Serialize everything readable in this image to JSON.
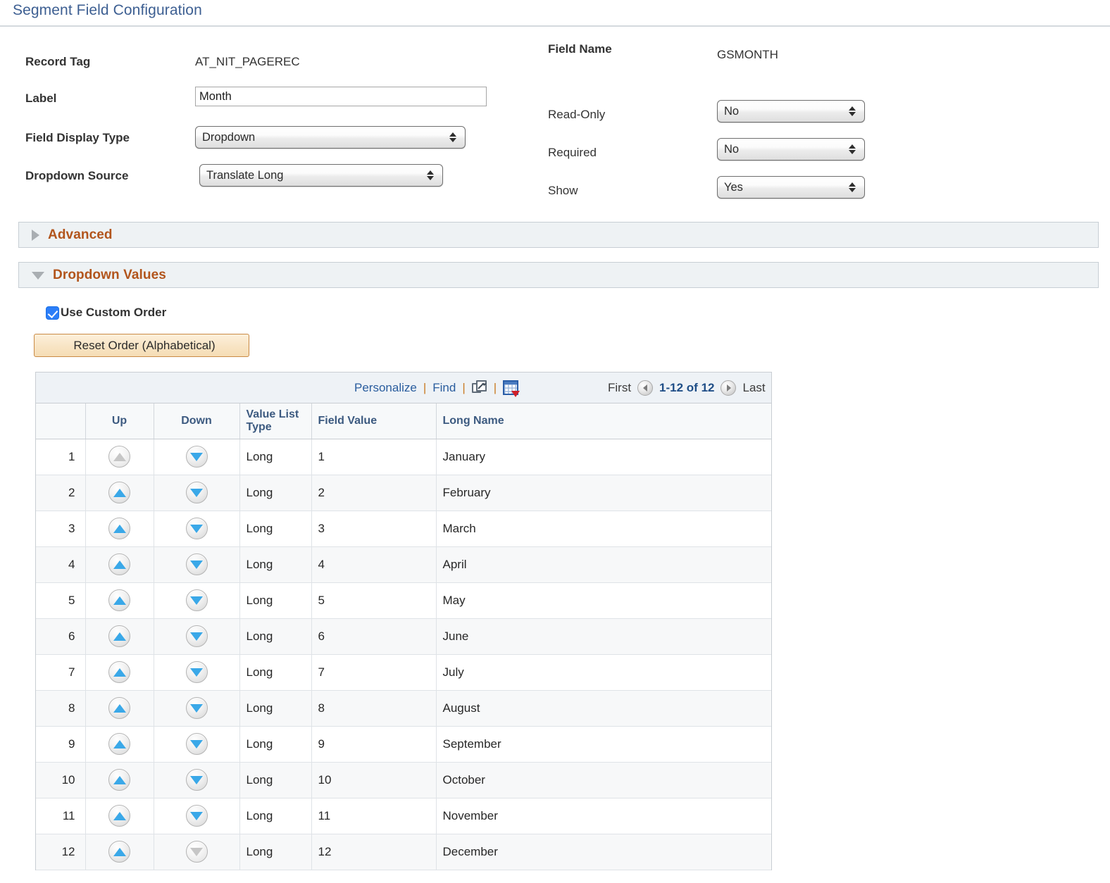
{
  "page": {
    "title": "Segment Field Configuration"
  },
  "form": {
    "record_tag_label": "Record Tag",
    "record_tag_value": "AT_NIT_PAGEREC",
    "label_label": "Label",
    "label_value": "Month",
    "label_placeholder": "",
    "field_display_type_label": "Field Display Type",
    "field_display_type_value": "Dropdown",
    "dropdown_source_label": "Dropdown Source",
    "dropdown_source_value": "Translate Long",
    "field_name_label": "Field Name",
    "field_name_value": "GSMONTH",
    "read_only_label": "Read-Only",
    "read_only_value": "No",
    "required_label": "Required",
    "required_value": "No",
    "show_label": "Show",
    "show_value": "Yes"
  },
  "sections": {
    "advanced": {
      "label": "Advanced",
      "expanded": false
    },
    "dropdown_values": {
      "label": "Dropdown Values",
      "expanded": true
    }
  },
  "options": {
    "use_custom_order_label": "Use Custom Order",
    "use_custom_order_checked": true,
    "reset_order_button": "Reset Order (Alphabetical)"
  },
  "grid": {
    "toolbar": {
      "personalize": "Personalize",
      "find": "Find",
      "separator": "|",
      "new_window_icon": "new-window-icon",
      "download_excel_icon": "download-to-excel-icon",
      "first": "First",
      "range": "1-12 of 12",
      "last": "Last"
    },
    "columns": [
      "",
      "Up",
      "Down",
      "Value List Type",
      "Field Value",
      "Long Name"
    ],
    "rows": [
      {
        "num": "1",
        "up_enabled": false,
        "down_enabled": true,
        "value_list_type": "Long",
        "field_value": "1",
        "long_name": "January"
      },
      {
        "num": "2",
        "up_enabled": true,
        "down_enabled": true,
        "value_list_type": "Long",
        "field_value": "2",
        "long_name": "February"
      },
      {
        "num": "3",
        "up_enabled": true,
        "down_enabled": true,
        "value_list_type": "Long",
        "field_value": "3",
        "long_name": "March"
      },
      {
        "num": "4",
        "up_enabled": true,
        "down_enabled": true,
        "value_list_type": "Long",
        "field_value": "4",
        "long_name": "April"
      },
      {
        "num": "5",
        "up_enabled": true,
        "down_enabled": true,
        "value_list_type": "Long",
        "field_value": "5",
        "long_name": "May"
      },
      {
        "num": "6",
        "up_enabled": true,
        "down_enabled": true,
        "value_list_type": "Long",
        "field_value": "6",
        "long_name": "June"
      },
      {
        "num": "7",
        "up_enabled": true,
        "down_enabled": true,
        "value_list_type": "Long",
        "field_value": "7",
        "long_name": "July"
      },
      {
        "num": "8",
        "up_enabled": true,
        "down_enabled": true,
        "value_list_type": "Long",
        "field_value": "8",
        "long_name": "August"
      },
      {
        "num": "9",
        "up_enabled": true,
        "down_enabled": true,
        "value_list_type": "Long",
        "field_value": "9",
        "long_name": "September"
      },
      {
        "num": "10",
        "up_enabled": true,
        "down_enabled": true,
        "value_list_type": "Long",
        "field_value": "10",
        "long_name": "October"
      },
      {
        "num": "11",
        "up_enabled": true,
        "down_enabled": true,
        "value_list_type": "Long",
        "field_value": "11",
        "long_name": "November"
      },
      {
        "num": "12",
        "up_enabled": true,
        "down_enabled": false,
        "value_list_type": "Long",
        "field_value": "12",
        "long_name": "December"
      }
    ]
  },
  "colors": {
    "title_blue": "#3d5f92",
    "section_orange": "#b2551c",
    "link_blue": "#2a5d9e",
    "header_text": "#3c5a80",
    "arrow_blue": "#3aa8e8",
    "checkbox_blue": "#2c7ef8",
    "button_border": "#c98a45"
  }
}
